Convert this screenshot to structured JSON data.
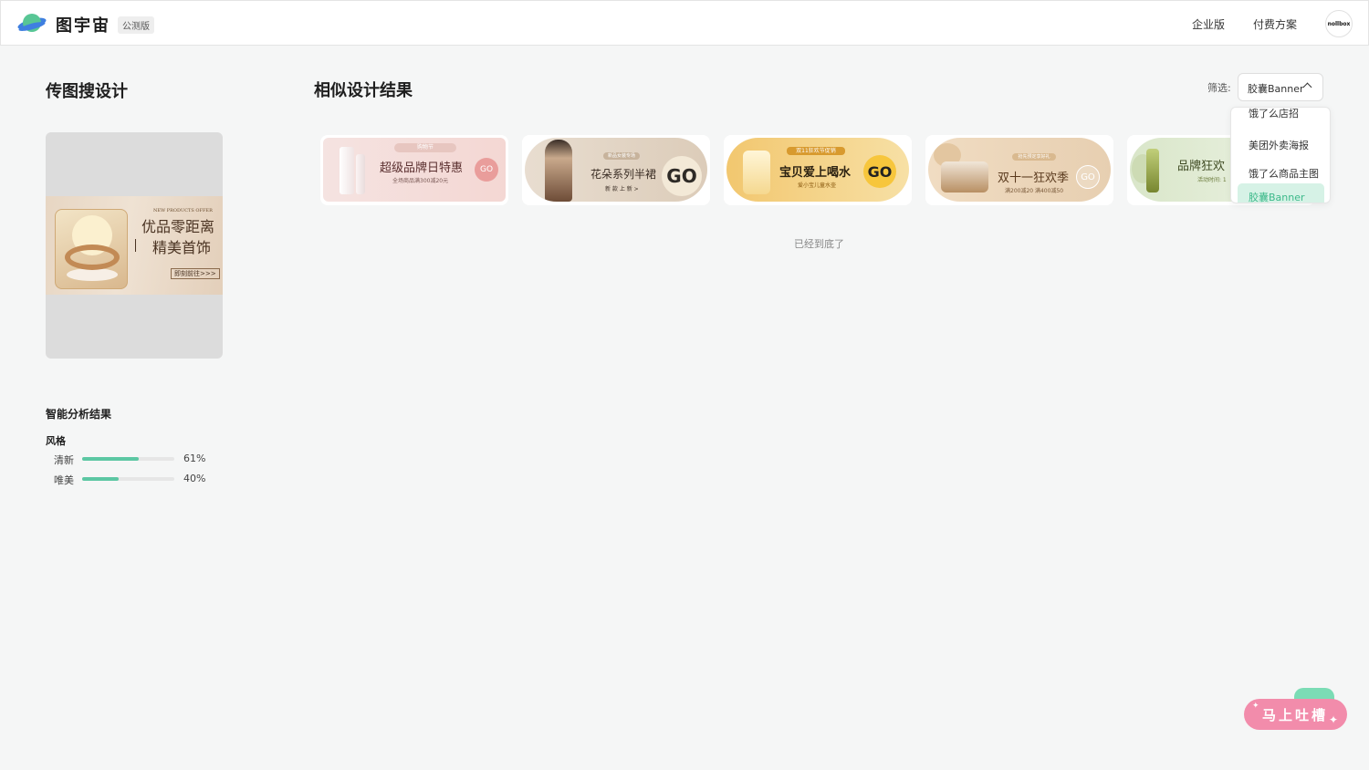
{
  "header": {
    "brand": "图宇宙",
    "badge": "公测版",
    "nav": [
      "企业版",
      "付费方案"
    ],
    "avatar_text": "nollbox"
  },
  "sidebar": {
    "title": "传图搜设计",
    "query_image": {
      "en": "NEW PRODUCTS OFFER",
      "line1": "优品零距离",
      "line2": "精美首饰",
      "button": "即刻前往>>>"
    },
    "analysis_title": "智能分析结果",
    "style_label": "风格",
    "stats": [
      {
        "name": "清新",
        "percent": "61%",
        "value": 61
      },
      {
        "name": "唯美",
        "percent": "40%",
        "value": 40
      }
    ]
  },
  "main": {
    "title": "相似设计结果",
    "filter_label": "筛选:",
    "filter_value": "胶囊Banner",
    "end_text": "已经到底了",
    "results": [
      {
        "tag": "购物节",
        "main": "超级品牌日特惠",
        "sub": "全场商品满300减20元",
        "go": "GO"
      },
      {
        "tag": "新品女装专场",
        "main": "花朵系列半裙",
        "sub": "新 款 上 新 >",
        "go": "GO"
      },
      {
        "tag": "双11狂欢节促销",
        "main": "宝贝爱上喝水",
        "sub": "爱小宝儿童水壶",
        "go": "GO"
      },
      {
        "tag": "抢先预定享好礼",
        "main": "双十一狂欢季",
        "sub": "满200减20 满400减50",
        "go": "GO"
      },
      {
        "main": "品牌狂欢",
        "sub": "活动时间: 1"
      }
    ]
  },
  "dropdown": {
    "options": [
      "饿了么店招",
      "美团外卖海报",
      "饿了么商品主图",
      "胶囊Banner"
    ],
    "selected": "胶囊Banner"
  },
  "feedback": {
    "label": "马上吐槽"
  },
  "colors": {
    "accent": "#5cc7a3",
    "feedback": "#f28cab",
    "selected_bg": "#d6f2e6"
  }
}
